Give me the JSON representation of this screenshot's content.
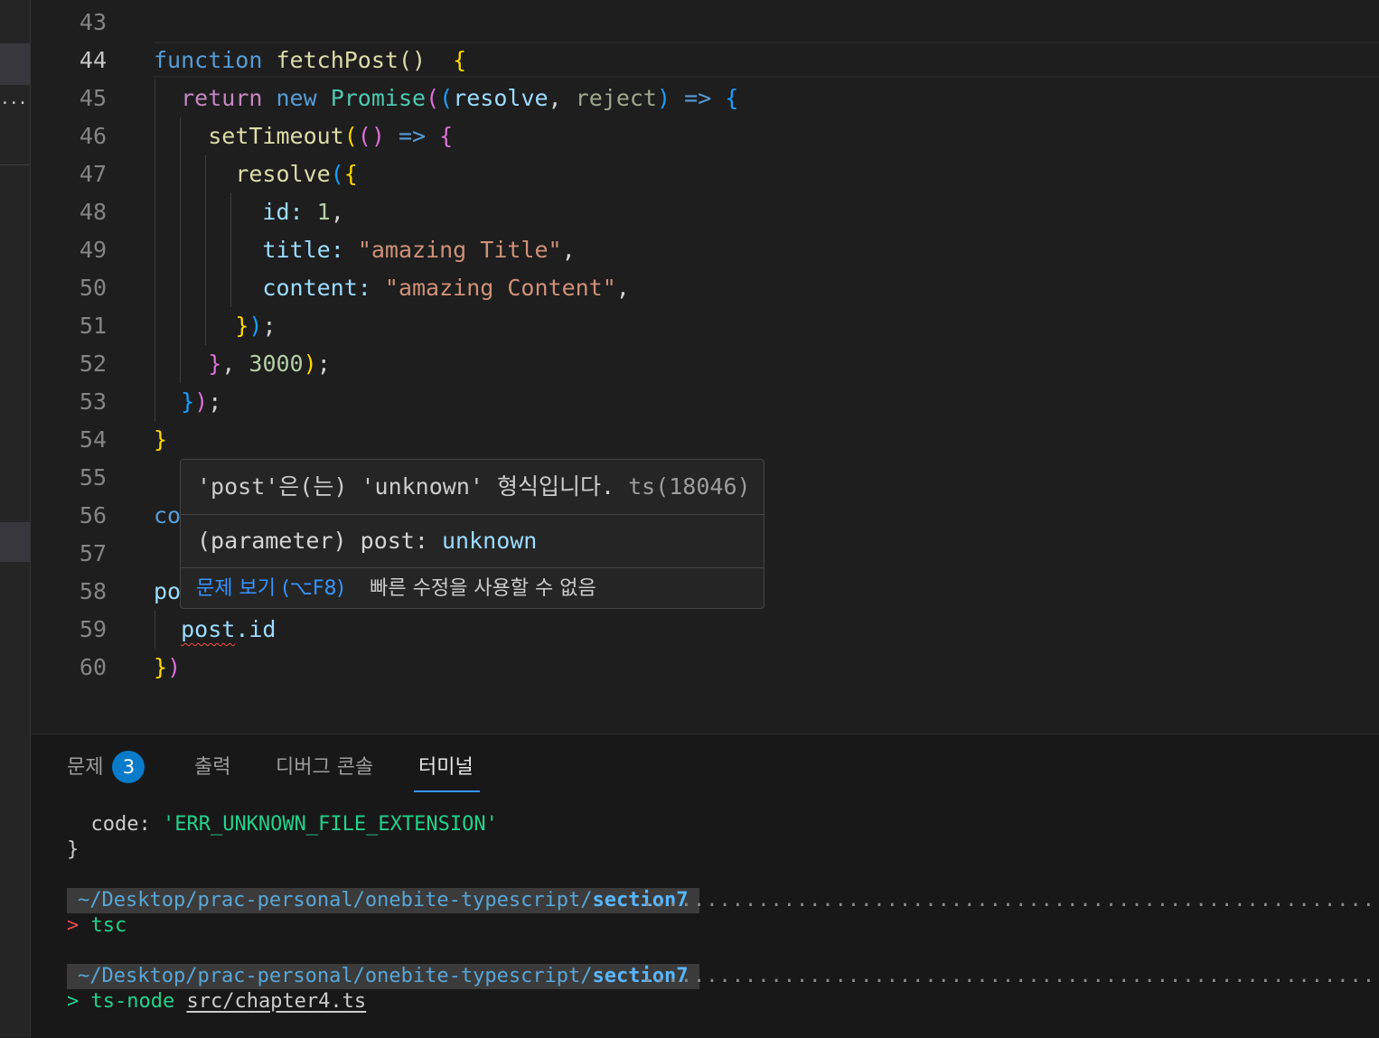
{
  "editor": {
    "line_numbers": [
      "43",
      "44",
      "45",
      "46",
      "47",
      "48",
      "49",
      "50",
      "51",
      "52",
      "53",
      "54",
      "55",
      "56",
      "57",
      "58",
      "59",
      "60"
    ],
    "active_line": "44",
    "code": {
      "l44": {
        "kw": "function",
        "fn": "fetchPost",
        "paren": "()",
        "brace": "{"
      },
      "l45": {
        "ret": "return",
        "new": "new",
        "ty": "Promise",
        "p1": "(",
        "p2": "(",
        "a1": "resolve",
        "comma": ",",
        "a2": "reject",
        "p3": ")",
        "arrow": "=>",
        "brace": "{"
      },
      "l46": {
        "fn": "setTimeout",
        "p1": "(",
        "p2": "()",
        "arrow": "=>",
        "brace": "{"
      },
      "l47": {
        "fn": "resolve",
        "p1": "(",
        "brace": "{"
      },
      "l48": {
        "key": "id",
        "colon": ":",
        "val": "1",
        "comma": ","
      },
      "l49": {
        "key": "title",
        "colon": ":",
        "val": "\"amazing Title\"",
        "comma": ","
      },
      "l50": {
        "key": "content",
        "colon": ":",
        "val": "\"amazing Content\"",
        "comma": ","
      },
      "l51": {
        "brace": "}",
        "paren": ")",
        "semi": ";"
      },
      "l52": {
        "brace": "}",
        "comma": ",",
        "num": "3000",
        "paren": ")",
        "semi": ";"
      },
      "l53": {
        "brace": "}",
        "paren": ")",
        "semi": ";"
      },
      "l54": {
        "brace": "}"
      },
      "l56": {
        "text": "co"
      },
      "l58": {
        "text": "po"
      },
      "l59": {
        "obj": "post",
        "prop": ".id"
      },
      "l60": {
        "brace": "}",
        "paren": ")"
      }
    }
  },
  "hover": {
    "message": "'post'은(는) 'unknown' 형식입니다.",
    "code_ref": "ts(18046)",
    "sig_kind": "(parameter)",
    "sig_name": "post",
    "sig_colon": ":",
    "sig_type": "unknown",
    "view_problem": "문제 보기 (⌥F8)",
    "no_quick_fix": "빠른 수정을 사용할 수 없음"
  },
  "panel": {
    "tabs": [
      {
        "label": "문제",
        "badge": "3"
      },
      {
        "label": "출력"
      },
      {
        "label": "디버그 콘솔"
      },
      {
        "label": "터미널"
      }
    ],
    "terminal": {
      "line1_key": "  code:",
      "line1_val": "'ERR_UNKNOWN_FILE_EXTENSION'",
      "line2": "}",
      "path_prefix": "~/Desktop/prac-personal/onebite-typescript/",
      "path_dir": "section7",
      "dots": "..........................................................................................................................",
      "prompt_glyph": ">",
      "cmd1": "tsc",
      "cmd2": "ts-node",
      "cmd2_arg": "src/chapter4.ts"
    }
  },
  "colors": {
    "accent": "#3794ff",
    "error": "#f14c4c",
    "terminal_green": "#23d18b",
    "badge": "#0a7aca"
  }
}
